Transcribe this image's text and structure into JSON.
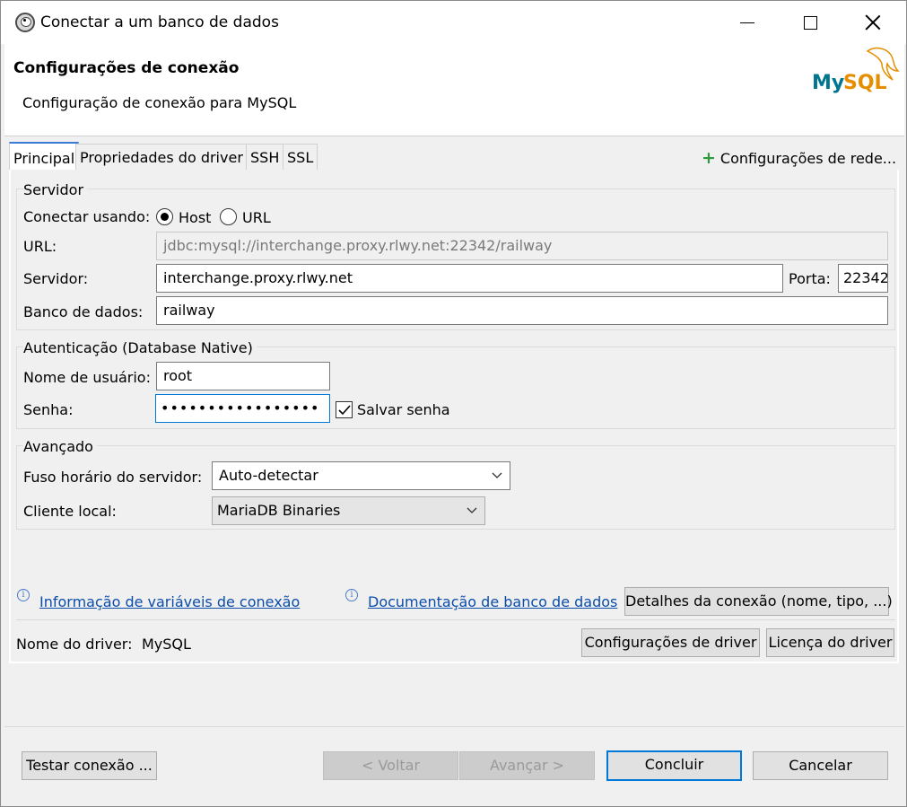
{
  "window": {
    "title": "Conectar a um banco de dados"
  },
  "header": {
    "title": "Configurações de conexão",
    "subtitle": "Configuração de conexão para MySQL",
    "logo_text": "MySQL"
  },
  "tabs": [
    {
      "label": "Principal",
      "active": true
    },
    {
      "label": "Propriedades do driver",
      "active": false
    },
    {
      "label": "SSH",
      "active": false
    },
    {
      "label": "SSL",
      "active": false
    }
  ],
  "network_config_label": "Configurações de rede...",
  "server": {
    "group_title": "Servidor",
    "connect_using_label": "Conectar usando:",
    "option_host": "Host",
    "option_url": "URL",
    "selected": "Host",
    "url_label": "URL:",
    "url_value": "jdbc:mysql://interchange.proxy.rlwy.net:22342/railway",
    "host_label": "Servidor:",
    "host_value": "interchange.proxy.rlwy.net",
    "port_label": "Porta:",
    "port_value": "22342",
    "database_label": "Banco de dados:",
    "database_value": "railway"
  },
  "auth": {
    "group_title": "Autenticação (Database Native)",
    "username_label": "Nome de usuário:",
    "username_value": "root",
    "password_label": "Senha:",
    "password_masked": "•••••••••••••••••",
    "save_password_label": "Salvar senha",
    "save_password_checked": true
  },
  "advanced": {
    "group_title": "Avançado",
    "timezone_label": "Fuso horário do servidor:",
    "timezone_value": "Auto-detectar",
    "local_client_label": "Cliente local:",
    "local_client_value": "MariaDB Binaries"
  },
  "links": {
    "variables_info": "Informação de variáveis de conexão",
    "db_docs": "Documentação de banco de dados",
    "connection_details_button": "Detalhes da conexão (nome, tipo, ...)"
  },
  "driver": {
    "name_label": "Nome do driver:",
    "name_value": "MySQL",
    "settings_button": "Configurações de driver",
    "license_button": "Licença do driver"
  },
  "footer": {
    "test_button": "Testar conexão ...",
    "back_button": "< Voltar",
    "next_button": "Avançar >",
    "finish_button": "Concluir",
    "cancel_button": "Cancelar"
  }
}
